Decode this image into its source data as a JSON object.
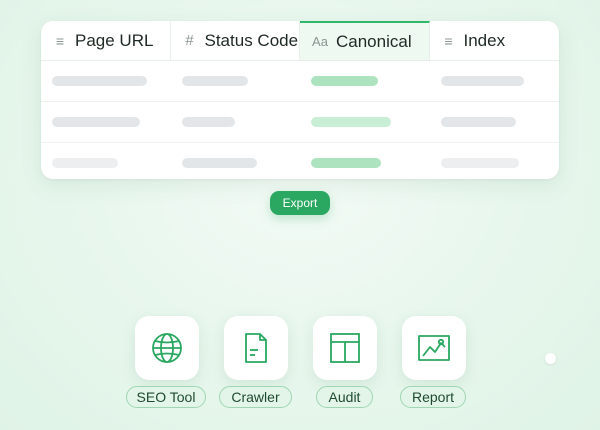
{
  "table": {
    "columns": [
      {
        "label": "Page URL",
        "icon": "text-lines-icon"
      },
      {
        "label": "Status Code",
        "icon": "hash-icon"
      },
      {
        "label": "Canonical",
        "icon": "text-type-icon",
        "active": true
      },
      {
        "label": "Index",
        "icon": "text-lines-icon"
      }
    ]
  },
  "export_button": {
    "label": "Export"
  },
  "tools": [
    {
      "label": "SEO Tool",
      "icon": "globe-icon"
    },
    {
      "label": "Crawler",
      "icon": "document-icon"
    },
    {
      "label": "Audit",
      "icon": "layout-grid-icon"
    },
    {
      "label": "Report",
      "icon": "image-chart-icon"
    }
  ],
  "colors": {
    "accent": "#2aa760",
    "accent_light": "#aee3c0",
    "label_bg": "#e3f5e9",
    "placeholder": "#e3e6e9"
  }
}
